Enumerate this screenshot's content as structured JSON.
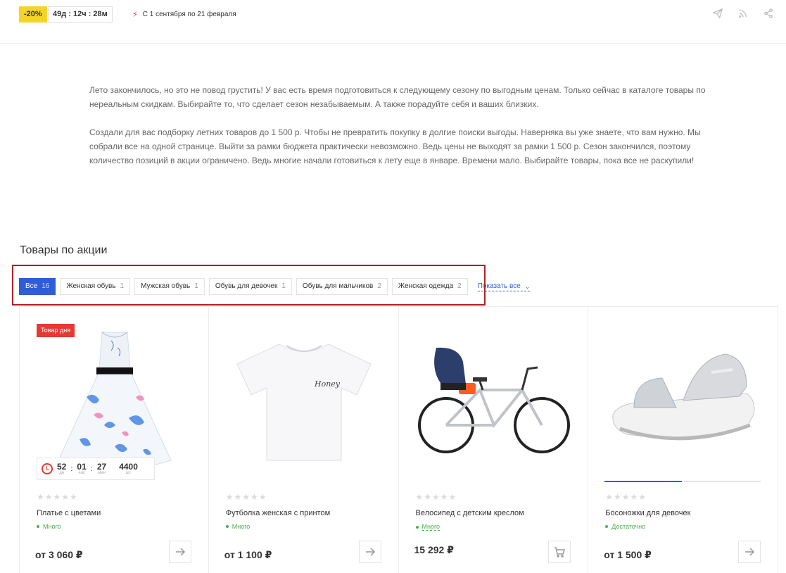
{
  "promo": {
    "discount": "-20%",
    "countdown": "49д : 12ч : 28м",
    "period": "С 1 сентября по 21 февраля"
  },
  "share_icons": [
    "send-icon",
    "rss-icon",
    "share-icon"
  ],
  "description": {
    "p1": "Лето закончилось, но это не повод грустить! У вас есть время подготовиться к следующему сезону по выгодным ценам. Только сейчас в каталоге товары по нереальным скидкам. Выбирайте то, что сделает сезон незабываемым. А также порадуйте себя и ваших близких.",
    "p2": "Создали для вас подборку летних товаров до 1 500 р. Чтобы не превратить покупку в долгие поиски выгоды. Наверняка вы уже знаете, что вам нужно. Мы собрали все на одной странице. Выйти за рамки бюджета практически невозможно. Ведь цены не выходят за рамки 1 500 р. Сезон закончился, поэтому количество позиций в акции ограничено. Ведь многие начали готовиться к лету еще в январе. Времени мало. Выбирайте товары, пока все не раскупили!"
  },
  "section_title": "Товары по акции",
  "filters": [
    {
      "label": "Все",
      "count": "16",
      "active": true
    },
    {
      "label": "Женская обувь",
      "count": "1"
    },
    {
      "label": "Мужская обувь",
      "count": "1"
    },
    {
      "label": "Обувь для девочек",
      "count": "1"
    },
    {
      "label": "Обувь для мальчиков",
      "count": "2"
    },
    {
      "label": "Женская одежда",
      "count": "2"
    }
  ],
  "show_all": "Показать все",
  "products": [
    {
      "name": "Платье с цветами",
      "availability": "Много",
      "price": "от 3 060 ₽",
      "badge": "Товар дня",
      "timer": {
        "d": "52",
        "d_label": "дн",
        "h": "01",
        "h_label": "час",
        "m": "27",
        "m_label": "мин",
        "qty": "4400",
        "qty_label": "шт"
      }
    },
    {
      "name": "Футболка женская с принтом",
      "availability": "Много",
      "price": "от 1 100 ₽"
    },
    {
      "name": "Велосипед с детским креслом",
      "availability": "Много",
      "price": "15 292 ₽"
    },
    {
      "name": "Босоножки для девочек",
      "availability": "Достаточно",
      "price": "от 1 500 ₽"
    }
  ],
  "colors": {
    "accent": "#2f5dd6",
    "promo_yellow": "#f5d42a",
    "badge_red": "#e53935",
    "in_stock": "#4caf50",
    "highlight_border": "#b02024"
  }
}
